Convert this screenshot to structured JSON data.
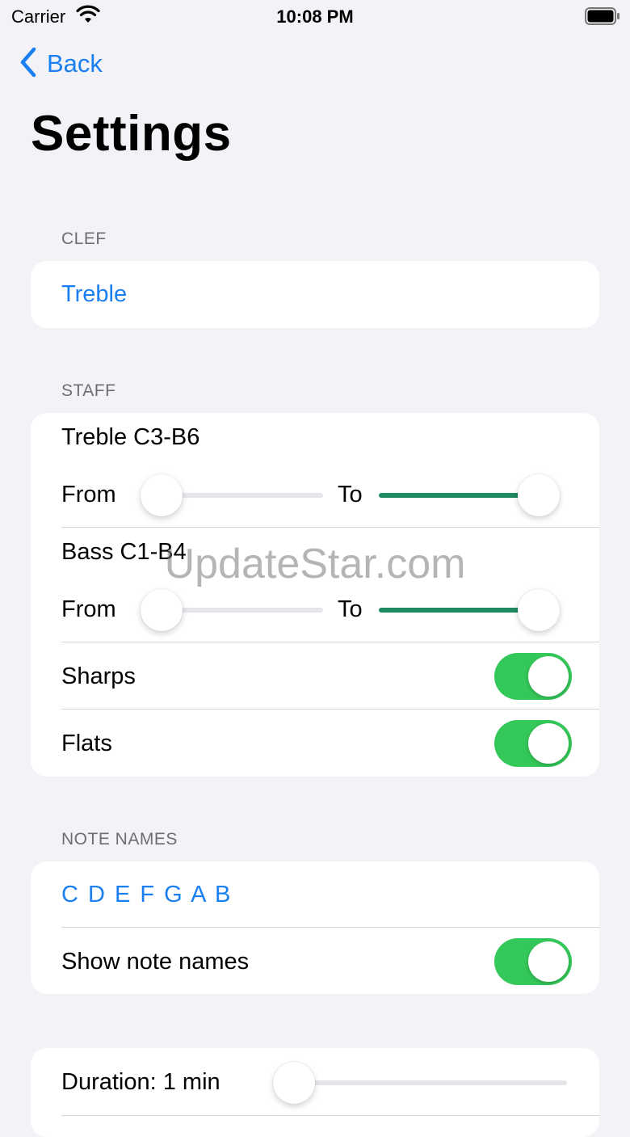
{
  "status_bar": {
    "carrier": "Carrier",
    "time": "10:08 PM",
    "icons": [
      "wifi-icon",
      "battery-icon"
    ]
  },
  "nav": {
    "back_label": "Back",
    "back_icon": "chevron-left-icon"
  },
  "page_title": "Settings",
  "clef_section": {
    "header": "CLEF",
    "value": "Treble"
  },
  "staff_section": {
    "header": "STAFF",
    "treble": {
      "title": "Treble C3-B6",
      "from_label": "From",
      "to_label": "To",
      "from_value": 0,
      "to_value": 1
    },
    "bass": {
      "title": "Bass C1-B4",
      "from_label": "From",
      "to_label": "To",
      "from_value": 0,
      "to_value": 1
    },
    "sharps": {
      "label": "Sharps",
      "on": true
    },
    "flats": {
      "label": "Flats",
      "on": true
    }
  },
  "note_names_section": {
    "header": "NOTE NAMES",
    "notes": "C D E F G A B",
    "show_note_names": {
      "label": "Show note names",
      "on": true
    }
  },
  "duration_section": {
    "label": "Duration: 1 min",
    "value": 0
  },
  "watermark": "UpdateStar.com",
  "colors": {
    "accent": "#1a7ff0",
    "toggle_on": "#34c759",
    "slider_fill": "#1f8a5f",
    "background": "#f2f2f7"
  }
}
